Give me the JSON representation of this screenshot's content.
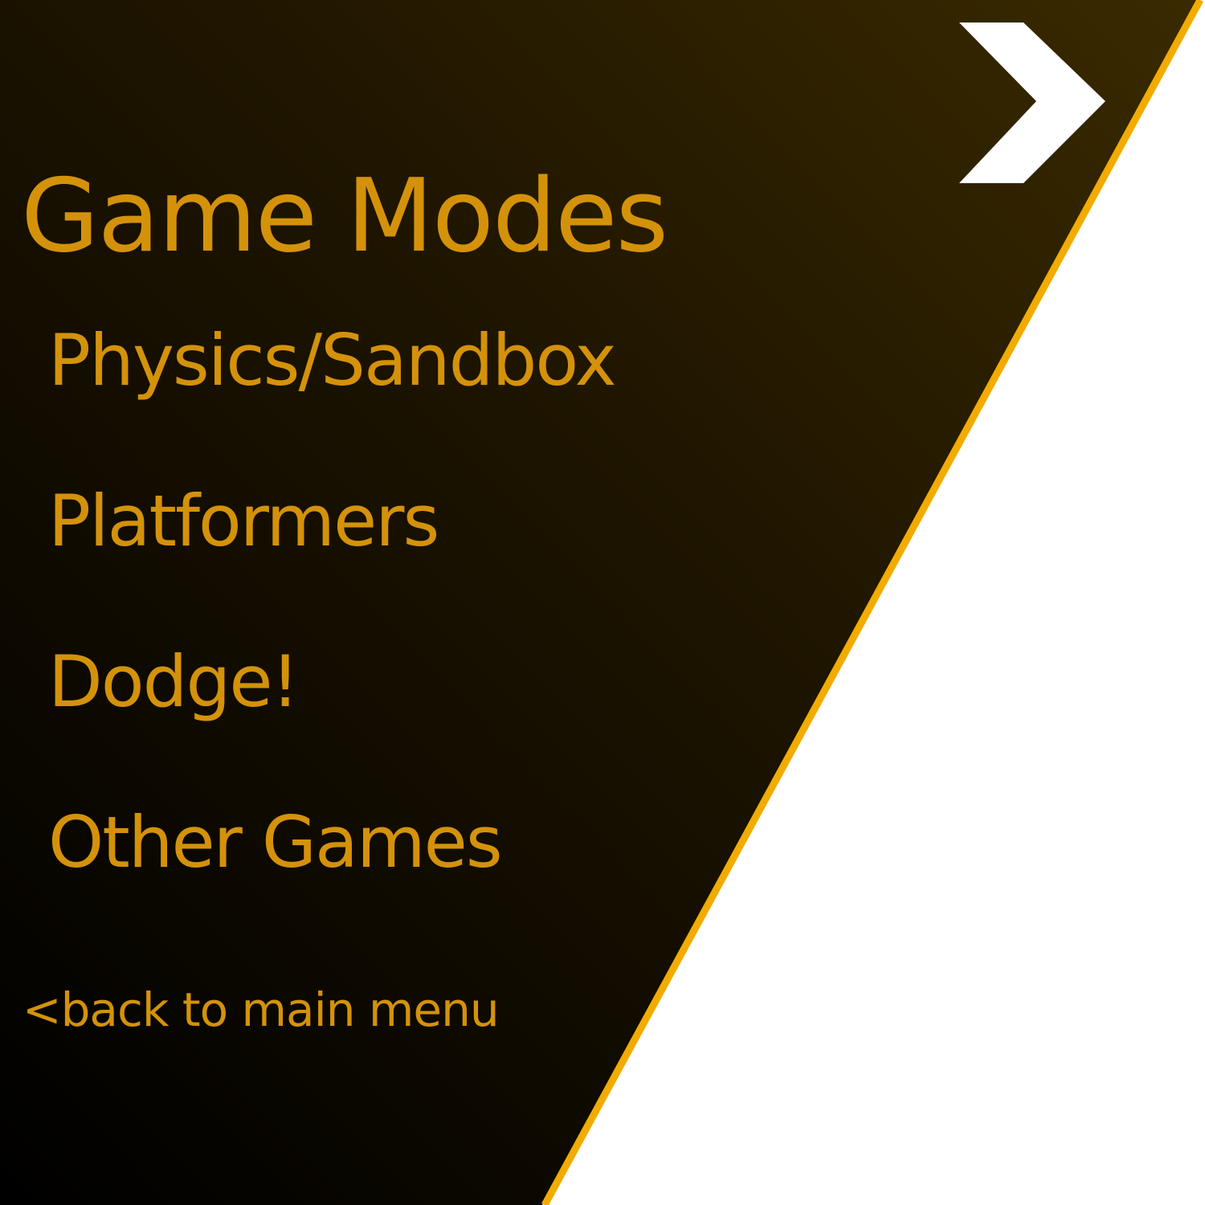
{
  "screen": {
    "title": "Game Modes",
    "menu_items": [
      {
        "label": "Physics/Sandbox"
      },
      {
        "label": "Platformers"
      },
      {
        "label": "Dodge!"
      },
      {
        "label": "Other Games"
      }
    ],
    "back_label": "<back to main menu",
    "next_icon": "chevron-right-icon"
  },
  "colors": {
    "text": "#d4920a",
    "panel_dark": "#000000",
    "panel_brown": "#2e2000",
    "stripe": "#f2ab00",
    "right_area": "#ffffff",
    "chevron": "#ffffff"
  }
}
